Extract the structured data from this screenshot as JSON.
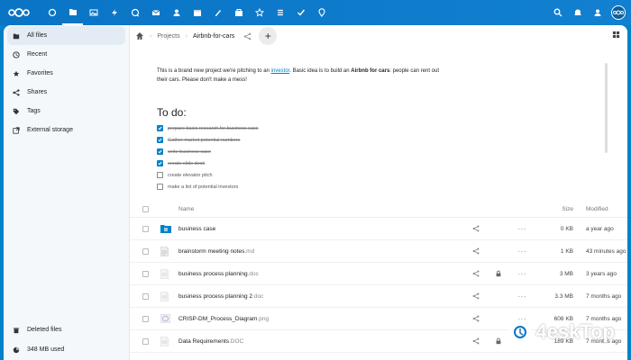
{
  "header": {
    "apps": [
      "dashboard-icon",
      "files-icon",
      "photos-icon",
      "activity-icon",
      "talk-icon",
      "mail-icon",
      "contacts-icon",
      "calendar-icon",
      "notes-icon",
      "deck-icon",
      "starred-icon",
      "tasks-icon",
      "checklist-icon",
      "maps-icon"
    ],
    "right": [
      "search-icon",
      "notifications-icon",
      "contacts-menu-icon"
    ]
  },
  "sidebar": {
    "items": [
      {
        "label": "All files",
        "icon": "folder-icon",
        "active": true
      },
      {
        "label": "Recent",
        "icon": "clock-icon"
      },
      {
        "label": "Favorites",
        "icon": "star-icon"
      },
      {
        "label": "Shares",
        "icon": "share-icon"
      },
      {
        "label": "Tags",
        "icon": "tag-icon"
      },
      {
        "label": "External storage",
        "icon": "external-icon"
      }
    ],
    "bottom": [
      {
        "label": "Deleted files",
        "icon": "trash-icon"
      },
      {
        "label": "348 MB used",
        "icon": "pie-icon"
      }
    ]
  },
  "breadcrumb": {
    "items": [
      "Projects",
      "Airbnb-for-cars"
    ]
  },
  "readme": {
    "text_before_link": "This is a brand new project we're pitching to an ",
    "link": "investor",
    "text_after_link": ". Basic idea is to build an ",
    "bold": "Airbnb for cars",
    "text_end": ": people can rent out their cars. Please don't make a mess!",
    "todo_title": "To do:",
    "todos": [
      {
        "text": "prepare basic research for business case",
        "done": true
      },
      {
        "text": "Gather market potential numbers",
        "done": true
      },
      {
        "text": "write business case",
        "done": true
      },
      {
        "text": "create slide deck",
        "done": true
      },
      {
        "text": "create elevator pitch",
        "done": false
      },
      {
        "text": "make a list of potential investors",
        "done": false
      }
    ]
  },
  "table": {
    "headers": {
      "name": "Name",
      "size": "Size",
      "modified": "Modified"
    },
    "rows": [
      {
        "name": "business case",
        "ext": "",
        "type": "folder",
        "size": "0 KB",
        "modified": "a year ago",
        "locked": false
      },
      {
        "name": "brainstorm meeting notes",
        "ext": ".md",
        "type": "text",
        "size": "1 KB",
        "modified": "43 minutes ago",
        "locked": false
      },
      {
        "name": "business process planning",
        "ext": ".doc",
        "type": "doc",
        "size": "3 MB",
        "modified": "3 years ago",
        "locked": true
      },
      {
        "name": "business process planning 2",
        "ext": ".doc",
        "type": "doc",
        "size": "3.3 MB",
        "modified": "7 months ago",
        "locked": false
      },
      {
        "name": "CRISP-DM_Process_Diagram",
        "ext": ".png",
        "type": "image",
        "size": "608 KB",
        "modified": "7 months ago",
        "locked": false
      },
      {
        "name": "Data Requirements",
        "ext": ".DOC",
        "type": "doc",
        "size": "189 KB",
        "modified": "7 months ago",
        "locked": true
      }
    ]
  },
  "watermark": "4eskTop"
}
